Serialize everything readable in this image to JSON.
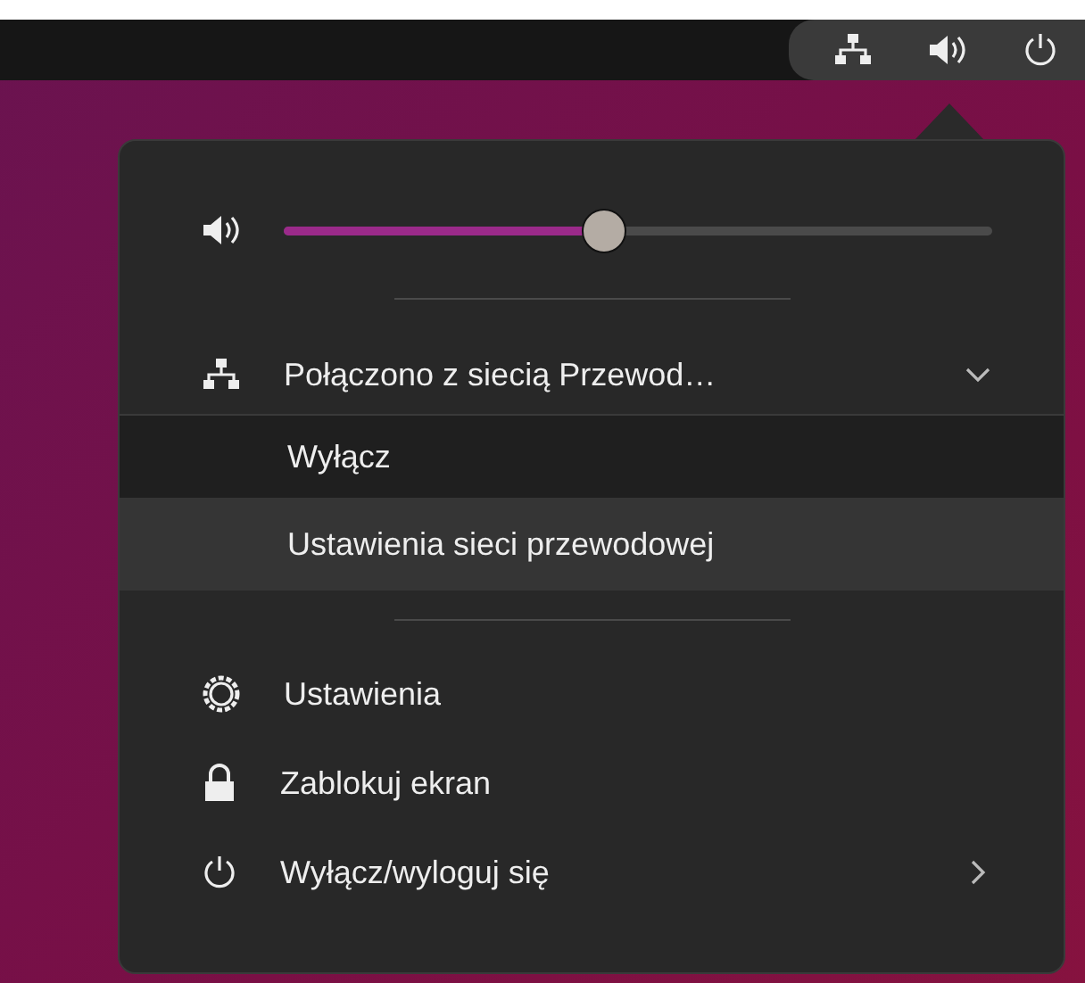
{
  "volume": {
    "level": 0.45
  },
  "network": {
    "label": "Połączono z siecią Przewod…",
    "expanded": true,
    "items": [
      {
        "label": "Wyłącz",
        "selected": false
      },
      {
        "label": "Ustawienia sieci przewodowej",
        "selected": true
      }
    ]
  },
  "actions": [
    {
      "kind": "settings",
      "label": "Ustawienia"
    },
    {
      "kind": "lock",
      "label": "Zablokuj ekran"
    },
    {
      "kind": "power",
      "label": "Wyłącz/wyloguj się",
      "submenu": true
    }
  ]
}
